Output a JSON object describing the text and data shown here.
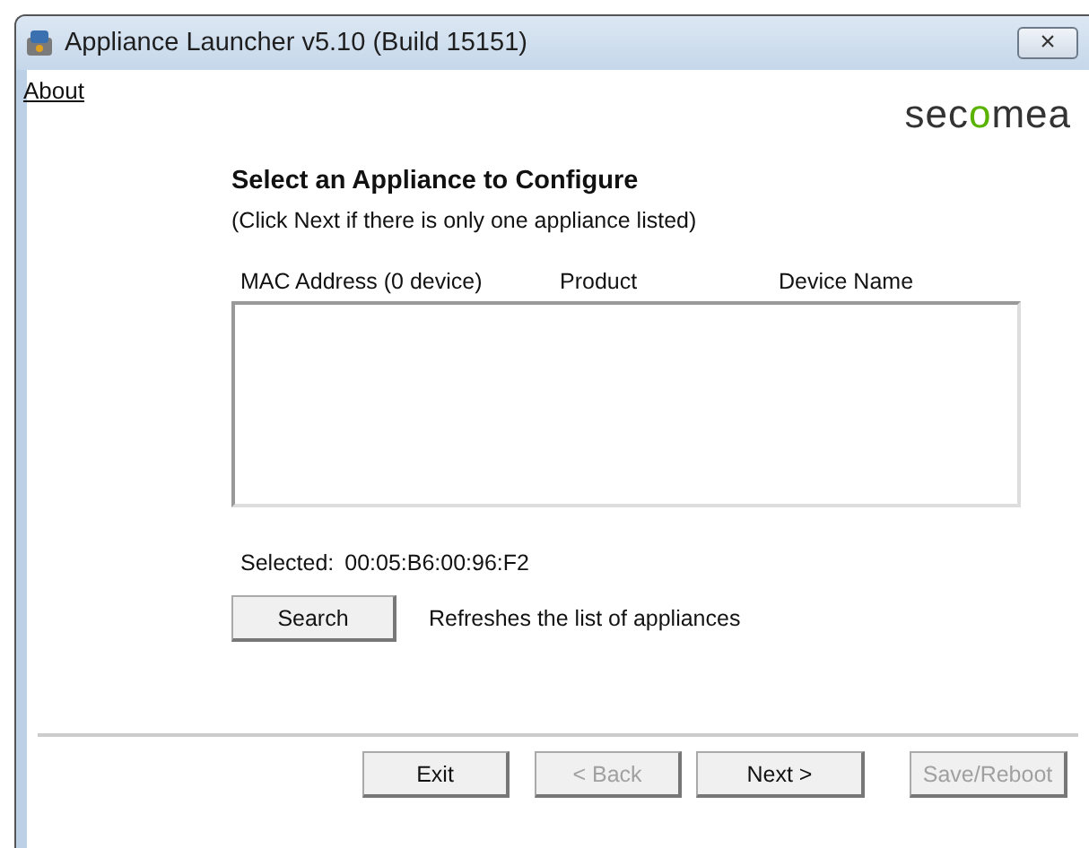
{
  "window": {
    "title": "Appliance Launcher v5.10 (Build 15151)",
    "close": "×"
  },
  "menu": {
    "about": "About"
  },
  "logo": "secomea",
  "heading": "Select an Appliance to Configure",
  "hint": "(Click Next if there is only one appliance listed)",
  "table": {
    "columns": [
      "MAC Address (0 device)",
      "Product",
      "Device Name"
    ]
  },
  "selected": {
    "label": "Selected:",
    "value": "00:05:B6:00:96:F2"
  },
  "search": {
    "button": "Search",
    "description": "Refreshes the list of appliances"
  },
  "buttons": [
    {
      "label": "Exit",
      "disabled": false
    },
    {
      "label": "< Back",
      "disabled": true
    },
    {
      "label": "Next >",
      "disabled": false
    },
    {
      "label": "Save/Reboot",
      "disabled": true
    }
  ]
}
